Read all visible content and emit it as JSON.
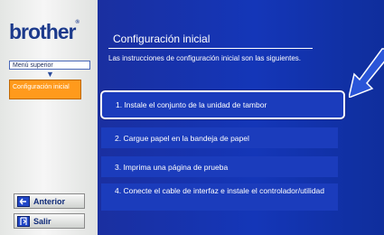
{
  "sidebar": {
    "logo": "brother",
    "logo_mark": "®",
    "nav_top": "Menú superior",
    "nav_current": "Configuración inicial",
    "prev_button": "Anterior",
    "exit_button": "Salir"
  },
  "main": {
    "title": "Configuración inicial",
    "subtitle": "Las instrucciones de configuración inicial son las siguientes.",
    "items": [
      "1. Instale el conjunto de la unidad de tambor",
      "2. Cargue papel en la bandeja de papel",
      "3. Imprima una página de prueba",
      "4. Conecte el cable de interfaz e instale el controlador/utilidad"
    ]
  },
  "colors": {
    "panel_blue": "#1436b8",
    "accent_orange": "#ff9a1c",
    "pointer_blue": "#1f4cc8"
  },
  "icons": [
    "back-arrow-icon",
    "exit-icon",
    "down-arrow-icon",
    "pointer-arrow-icon"
  ]
}
